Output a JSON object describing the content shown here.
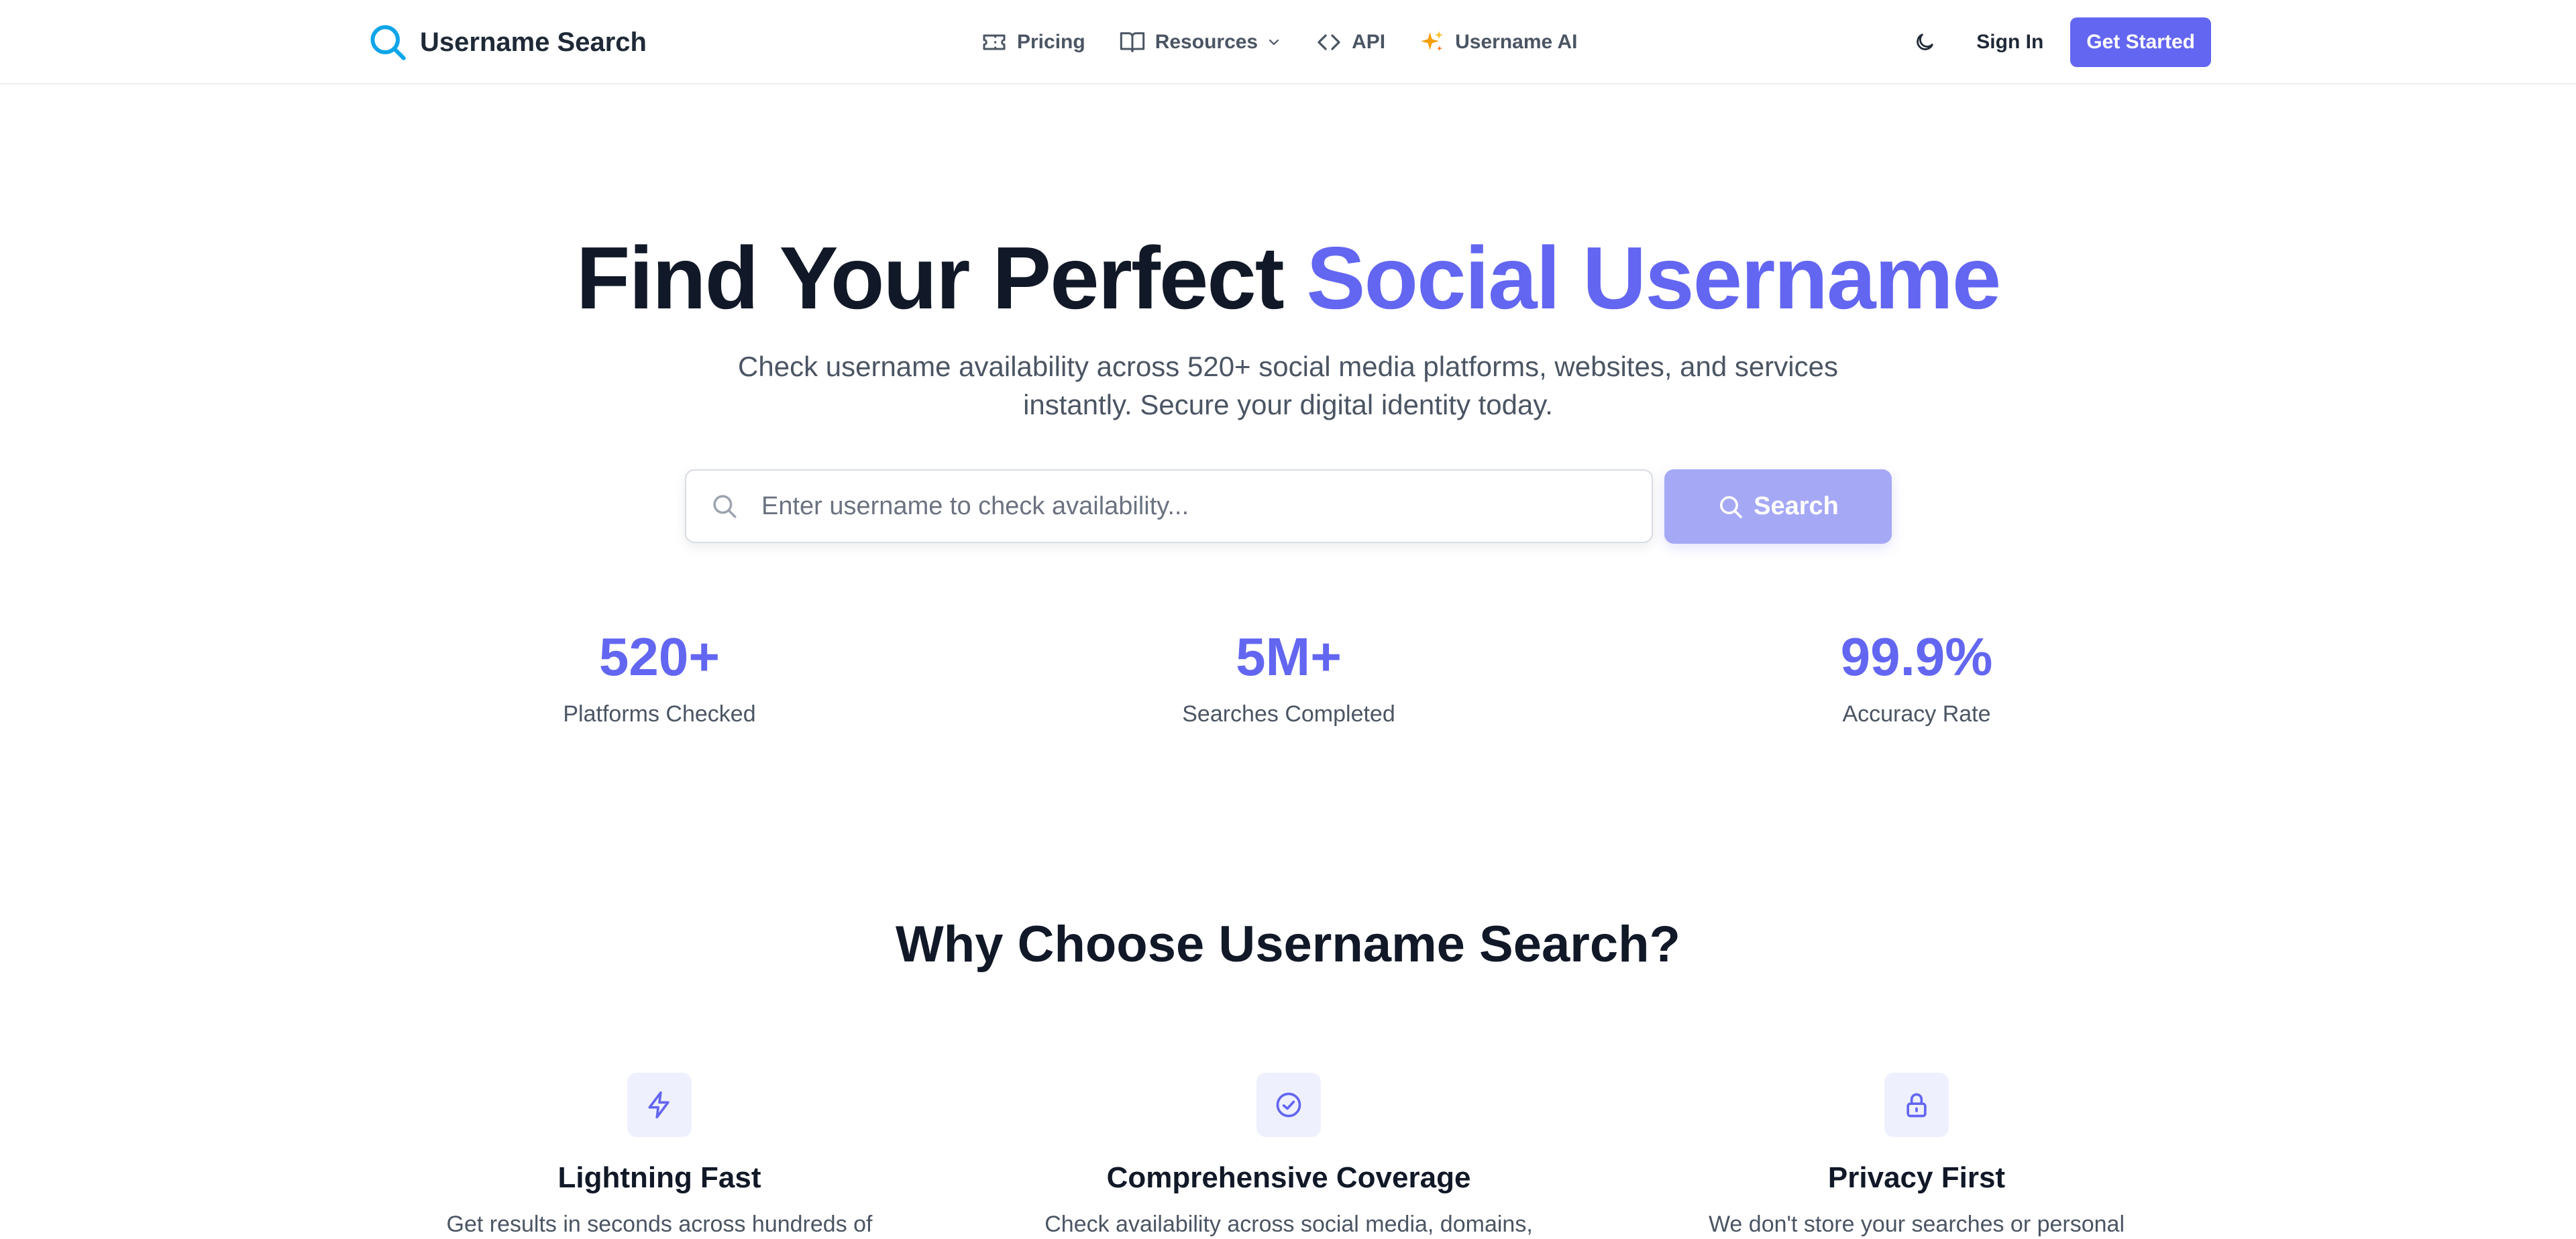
{
  "brand": {
    "name": "Username Search",
    "icon": "search-icon"
  },
  "nav": {
    "links": [
      {
        "label": "Pricing",
        "icon": "ticket-icon"
      },
      {
        "label": "Resources",
        "icon": "book-icon"
      },
      {
        "label": "API",
        "icon": "code-icon"
      },
      {
        "label": "Username AI",
        "icon": "sparkles-icon"
      }
    ],
    "theme_icon": "moon-icon",
    "sign_in": "Sign In",
    "get_started": "Get Started"
  },
  "hero": {
    "title_main": "Find Your Perfect ",
    "title_accent": "Social Username",
    "subtitle": "Check username availability across 520+ social media platforms, websites, and services instantly. Secure your digital identity today."
  },
  "search": {
    "placeholder": "Enter username to check availability...",
    "value": "",
    "button_label": "Search"
  },
  "stats": [
    {
      "value": "520+",
      "label": "Platforms Checked"
    },
    {
      "value": "5M+",
      "label": "Searches Completed"
    },
    {
      "value": "99.9%",
      "label": "Accuracy Rate"
    }
  ],
  "why": {
    "title": "Why Choose Username Search?",
    "features": [
      {
        "title": "Lightning Fast",
        "description": "Get results in seconds across hundreds of",
        "icon": "lightning-icon"
      },
      {
        "title": "Comprehensive Coverage",
        "description": "Check availability across social media, domains,",
        "icon": "check-circle-icon"
      },
      {
        "title": "Privacy First",
        "description": "We don't store your searches or personal",
        "icon": "lock-icon"
      }
    ]
  },
  "colors": {
    "accent": "#6366f1",
    "accent_light": "#a5a8f4",
    "brand_icon": "#0ea5e9",
    "sparkle": "#f59e0b",
    "text_dark": "#111827",
    "text_muted": "#4b5563"
  }
}
